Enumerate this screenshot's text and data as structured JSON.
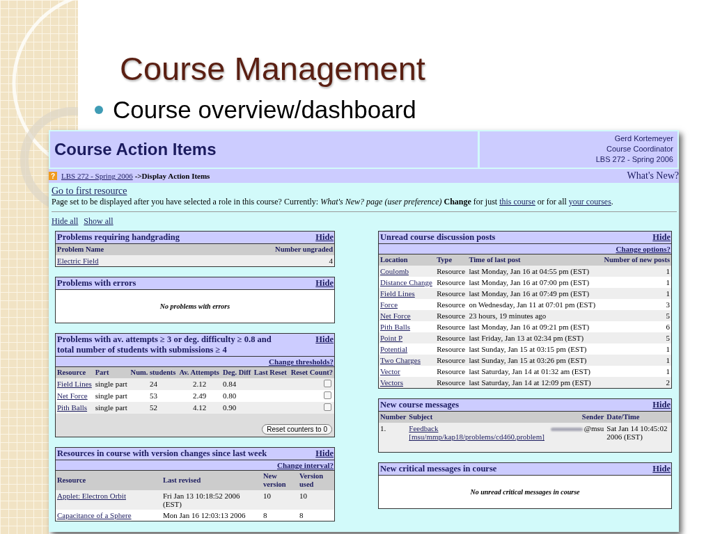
{
  "slide": {
    "title": "Course Management",
    "bullet": "Course overview/dashboard"
  },
  "screen": {
    "header": {
      "title": "Course Action Items",
      "user_lines": [
        "Gerd Kortemeyer",
        "Course Coordinator",
        "LBS 272 - Spring 2006"
      ]
    },
    "breadcrumb": {
      "help_icon": "?",
      "link": "LBS 272 - Spring 2006",
      "current": "->Display Action Items",
      "whats_new": "What's New?"
    },
    "first_resource_link": "Go to first resource",
    "preference": {
      "text": "Page set to be displayed after you have selected a role in this course? Currently: *What's New? page (user preference)*   **Change** for just",
      "link_1": "this course",
      "middle": "or for all",
      "link_2": "your courses",
      "end": "."
    },
    "view_links": [
      "Hide all",
      "Show all"
    ],
    "columns": [
      {
        "panels": [
          {
            "kind": "table",
            "title": "Problems requiring handgrading",
            "hide": "Hide",
            "columns": [
              {
                "label": "Problem Name",
                "kind": "link"
              },
              {
                "label": "Number ungraded",
                "kind": "count"
              }
            ],
            "rows": [
              {
                "cells": [
                  "Electric Field",
                  "4"
                ]
              }
            ]
          },
          {
            "kind": "empty",
            "title": "Problems with errors",
            "hide": "Hide",
            "empty_text": "No problems with errors"
          },
          {
            "kind": "table",
            "title": "Problems with av. attempts ≥ 3 or deg. difficulty ≥ 0.8 and total number of students with submissions ≥ 4",
            "hide": "Hide",
            "option_link": "Change thresholds?",
            "columns": [
              {
                "label": "Resource",
                "kind": "link"
              },
              {
                "label": "Part",
                "kind": "text"
              },
              {
                "label": "Num. students",
                "kind": "center"
              },
              {
                "label": "Av. Attempts",
                "kind": "center"
              },
              {
                "label": "Deg. Diff",
                "kind": "text"
              },
              {
                "label": "Last Reset",
                "kind": "text"
              },
              {
                "label": "Reset Count?",
                "kind": "check"
              }
            ],
            "rows": [
              {
                "cells": [
                  "Field Lines",
                  "single part",
                  "24",
                  "2.12",
                  "0.84",
                  ""
                ],
                "checked": false
              },
              {
                "cells": [
                  "Net Force",
                  "single part",
                  "53",
                  "2.49",
                  "0.80",
                  ""
                ],
                "checked": false
              },
              {
                "cells": [
                  "Pith Balls",
                  "single part",
                  "52",
                  "4.12",
                  "0.90",
                  ""
                ],
                "checked": false
              }
            ],
            "button": "Reset counters to 0"
          },
          {
            "kind": "table",
            "title": "Resources in course with version changes since last week",
            "hide": "Hide",
            "option_link": "Change interval?",
            "columns": [
              {
                "label": "Resource",
                "kind": "link"
              },
              {
                "label": "Last revised",
                "kind": "date"
              },
              {
                "label": "New version",
                "kind": "short"
              },
              {
                "label": "Version used",
                "kind": "short"
              }
            ],
            "rows": [
              {
                "cells": [
                  "Applet: Electron Orbit",
                  "Fri Jan 13 10:18:52 2006 (EST)",
                  "10",
                  "10"
                ]
              },
              {
                "cells": [
                  "Capacitance of a Sphere",
                  "Mon Jan 16 12:03:13 2006",
                  "8",
                  "8"
                ]
              }
            ]
          }
        ]
      },
      {
        "panels": [
          {
            "kind": "table",
            "title": "Unread course discussion posts",
            "hide": "Hide",
            "option_link": "Change options?",
            "columns": [
              {
                "label": "Location",
                "kind": "link"
              },
              {
                "label": "Type",
                "kind": "text"
              },
              {
                "label": "Time of last post",
                "kind": "text"
              },
              {
                "label": "Number of new posts",
                "kind": "count"
              }
            ],
            "rows": [
              {
                "cells": [
                  "Coulomb",
                  "Resource",
                  "last Monday, Jan 16 at 04:55 pm (EST)",
                  "1"
                ]
              },
              {
                "cells": [
                  "Distance Change",
                  "Resource",
                  "last Monday, Jan 16 at 07:00 pm (EST)",
                  "1"
                ]
              },
              {
                "cells": [
                  "Field Lines",
                  "Resource",
                  "last Monday, Jan 16 at 07:49 pm (EST)",
                  "1"
                ]
              },
              {
                "cells": [
                  "Force",
                  "Resource",
                  "on Wednesday, Jan 11 at 07:01 pm (EST)",
                  "3"
                ]
              },
              {
                "cells": [
                  "Net Force",
                  "Resource",
                  "23 hours, 19 minutes ago",
                  "5"
                ]
              },
              {
                "cells": [
                  "Pith Balls",
                  "Resource",
                  "last Monday, Jan 16 at 09:21 pm (EST)",
                  "6"
                ]
              },
              {
                "cells": [
                  "Point P",
                  "Resource",
                  "last Friday, Jan 13 at 02:34 pm (EST)",
                  "5"
                ]
              },
              {
                "cells": [
                  "Potential",
                  "Resource",
                  "last Sunday, Jan 15 at 03:15 pm (EST)",
                  "1"
                ]
              },
              {
                "cells": [
                  "Two Charges",
                  "Resource",
                  "last Sunday, Jan 15 at 03:26 pm (EST)",
                  "1"
                ]
              },
              {
                "cells": [
                  "Vector",
                  "Resource",
                  "last Saturday, Jan 14 at 01:32 am (EST)",
                  "1"
                ]
              },
              {
                "cells": [
                  "Vectors",
                  "Resource",
                  "last Saturday, Jan 14 at 12:09 pm (EST)",
                  "2"
                ]
              }
            ]
          },
          {
            "kind": "table",
            "title": "New course messages",
            "hide": "Hide",
            "columns": [
              {
                "label": "Number",
                "kind": "text"
              },
              {
                "label": "Subject",
                "kind": "wraplink"
              },
              {
                "label": "Sender",
                "kind": "sender"
              },
              {
                "label": "Date/Time",
                "kind": "datetime"
              }
            ],
            "rows": [
              {
                "cells": [
                  "1.",
                  "Feedback [msu/mmp/kap18/problems/cd460.problem]",
                  "@msu",
                  "Sat Jan 14 10:45:02 2006 (EST)"
                ]
              }
            ]
          },
          {
            "kind": "empty",
            "title": "New critical messages in course",
            "hide": "Hide",
            "empty_text": "No unread critical messages in course"
          }
        ]
      }
    ]
  }
}
